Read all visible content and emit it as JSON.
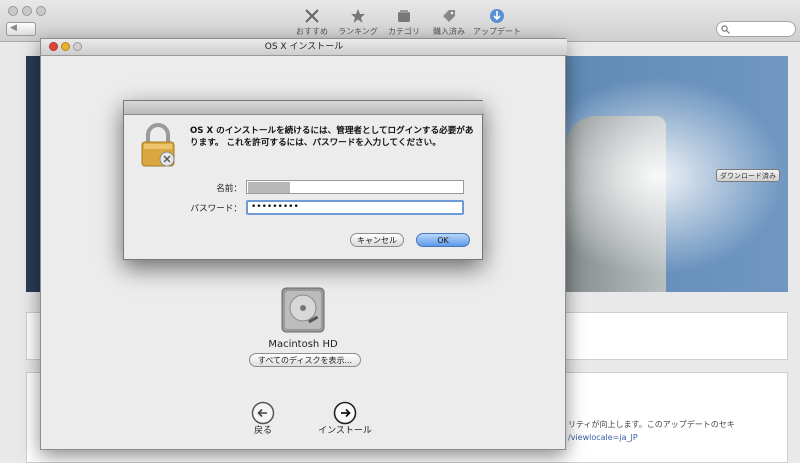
{
  "appstore": {
    "toolbar": [
      {
        "label": "おすすめ",
        "icon": "featured-icon"
      },
      {
        "label": "ランキング",
        "icon": "star-icon"
      },
      {
        "label": "カテゴリ",
        "icon": "categories-icon"
      },
      {
        "label": "購入済み",
        "icon": "purchased-tag-icon"
      },
      {
        "label": "アップデート",
        "icon": "updates-download-icon"
      }
    ],
    "nav_back": "◀",
    "download_badge": "ダウンロード済み",
    "update_text": "リティが向上します。このアップデートのセキ",
    "update_link": "/viewlocale=ja_JP"
  },
  "installer": {
    "title": "OS X インストール",
    "disk_label": "Macintosh HD",
    "show_disks_button": "すべてのディスクを表示...",
    "back_label": "戻る",
    "install_label": "インストール"
  },
  "auth_dialog": {
    "message": "OS X のインストールを続けるには、管理者としてログインする必要があります。 これを許可するには、パスワードを入力してください。",
    "name_label": "名前：",
    "name_value": "",
    "password_label": "パスワード：",
    "password_value": "•••••••••",
    "cancel_button": "キャンセル",
    "ok_button": "OK"
  },
  "colors": {
    "ok_accent": "#5d9bea",
    "focus_ring": "#6f9ad8",
    "close_red": "#e0453c",
    "minimize_yellow": "#e7b32a"
  }
}
